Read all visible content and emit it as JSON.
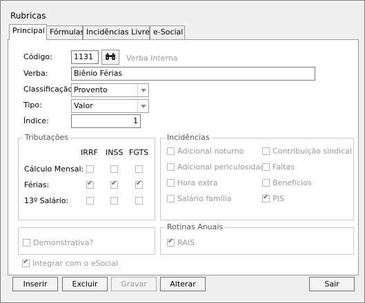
{
  "window": {
    "title": "Rubricas"
  },
  "tabs": [
    "Principal",
    "Fórmulas",
    "Incidências Livres",
    "e-Social"
  ],
  "form": {
    "codigo_label": "Código:",
    "codigo_value": "1131",
    "verba_interna_label": "Verba Interna",
    "verba_label": "Verba:",
    "verba_value": "Biênio Férias",
    "classificacao_label": "Classificação:",
    "classificacao_value": "Provento",
    "tipo_label": "Tipo:",
    "tipo_value": "Valor",
    "indice_label": "Índice:",
    "indice_value": "1"
  },
  "tributacoes": {
    "title": "Tributações",
    "columns": [
      "IRRF",
      "INSS",
      "FGTS"
    ],
    "rows": [
      {
        "label": "Cálculo Mensal:",
        "checked": [
          false,
          false,
          false
        ]
      },
      {
        "label": "Férias:",
        "checked": [
          true,
          true,
          true
        ]
      },
      {
        "label": "13º Salário:",
        "checked": [
          false,
          false,
          false
        ]
      }
    ]
  },
  "incidencias": {
    "title": "Incidências",
    "left": [
      {
        "label": "Adicional noturno",
        "checked": false
      },
      {
        "label": "Adicional periculosidade",
        "checked": false
      },
      {
        "label": "Hora extra",
        "checked": false
      },
      {
        "label": "Salário família",
        "checked": false
      }
    ],
    "right": [
      {
        "label": "Contribuição sindical",
        "checked": false
      },
      {
        "label": "Faltas",
        "checked": false
      },
      {
        "label": "Benefícios",
        "checked": false
      },
      {
        "label": "PIS",
        "checked": true
      }
    ]
  },
  "demonstrativa": {
    "label": "Demonstrativa?",
    "checked": false
  },
  "rotinas": {
    "title": "Rotinas Anuais",
    "rais_label": "RAIS",
    "rais_checked": true
  },
  "esocial": {
    "label": "Integrar com o eSocial",
    "checked": true
  },
  "buttons": {
    "inserir": "Inserir",
    "excluir": "Excluir",
    "gravar": "Gravar",
    "alterar": "Alterar",
    "sair": "Sair"
  },
  "icons": {
    "search": "binoculars-icon",
    "dropdown": "chevron-down-icon",
    "check": "checkmark-icon"
  }
}
